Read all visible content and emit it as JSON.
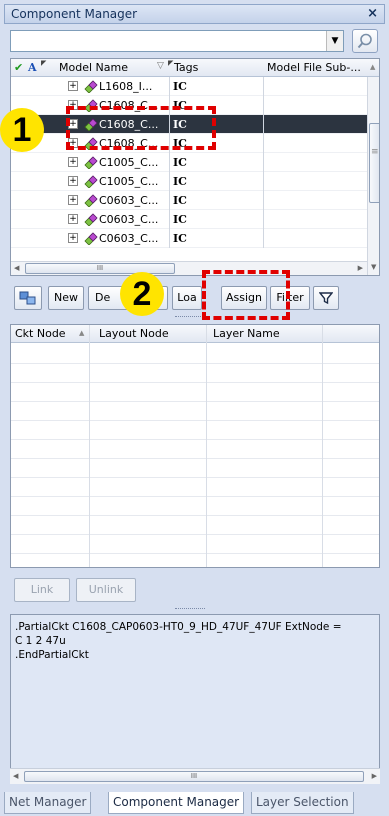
{
  "window": {
    "title": "Component Manager",
    "close_glyph": "×"
  },
  "search": {
    "value": "",
    "icon": "search-icon"
  },
  "model_table": {
    "headers": {
      "model_name": "Model Name",
      "tags": "Tags",
      "model_file": "Model File Sub-..."
    },
    "rows": [
      {
        "name": "L1608_I...",
        "tag": "IC"
      },
      {
        "name": "C1608_C...",
        "tag": "IC"
      },
      {
        "name": "C1608_C...",
        "tag": "IC",
        "selected": true
      },
      {
        "name": "C1608_C...",
        "tag": "IC"
      },
      {
        "name": "C1005_C...",
        "tag": "IC"
      },
      {
        "name": "C1005_C...",
        "tag": "IC"
      },
      {
        "name": "C0603_C...",
        "tag": "IC"
      },
      {
        "name": "C0603_C...",
        "tag": "IC"
      },
      {
        "name": "C0603_C...",
        "tag": "IC"
      }
    ],
    "hscroll_label": "III"
  },
  "toolbar": {
    "new": "New",
    "delete": "De",
    "load": "Loa",
    "assign": "Assign",
    "filter": "Filter"
  },
  "node_table": {
    "headers": {
      "ckt_node": "Ckt Node",
      "layout_node": "Layout Node",
      "layer_name": "Layer Name"
    }
  },
  "buttons": {
    "link": "Link",
    "unlink": "Unlink"
  },
  "netlist": {
    "lines": [
      ".PartialCkt C1608_CAP0603-HT0_9_HD_47UF_47UF ExtNode =",
      "C 1 2 47u",
      ".EndPartialCkt"
    ],
    "hscroll_label": "III"
  },
  "tabs": [
    "Net Manager",
    "Component Manager",
    "Layer Selection"
  ],
  "annotations": {
    "badge_1": "1",
    "badge_2": "2"
  },
  "colors": {
    "selection": "#2c3440",
    "annotation": "#e00000",
    "badge": "#ffe400"
  }
}
